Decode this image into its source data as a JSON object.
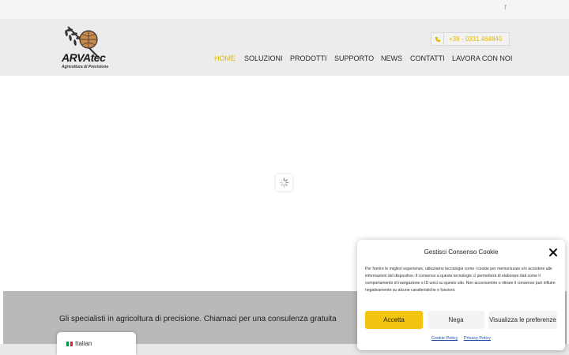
{
  "topbar": {
    "social_icon": "f"
  },
  "header": {
    "logo_name": "ARVAtec",
    "logo_tagline": "Agricoltura di Precisione",
    "phone_number": "+39 - 0331.464840",
    "nav": [
      "HOME",
      "SOLUZIONI",
      "PRODOTTI",
      "SUPPORTO",
      "NEWS",
      "CONTATTI",
      "LAVORA CON NOI"
    ],
    "active_nav": "HOME",
    "accent_color": "#e1b800"
  },
  "banner": {
    "text": "Gli specialisti in agricoltura di precisione. Chiamaci per una consulenza gratuita"
  },
  "language_switcher": {
    "label": "Italian"
  },
  "cookie_dialog": {
    "title": "Gestisci Consenso Cookie",
    "body": "Per fornire le migliori esperienze, utilizziamo tecnologie come i cookie per memorizzare e/o accedere alle informazioni del dispositivo. Il consenso a queste tecnologie ci permetterà di elaborare dati come il comportamento di navigazione o ID unici su questo sito. Non acconsentire o ritirare il consenso può influire negativamente su alcune caratteristiche e funzioni.",
    "accept_label": "Accetta",
    "deny_label": "Nega",
    "preferences_label": "Visualizza le preferenze",
    "cookie_policy_label": "Cookie Policy",
    "privacy_policy_label": "Privacy Policy",
    "accept_color": "#f1c40f"
  }
}
